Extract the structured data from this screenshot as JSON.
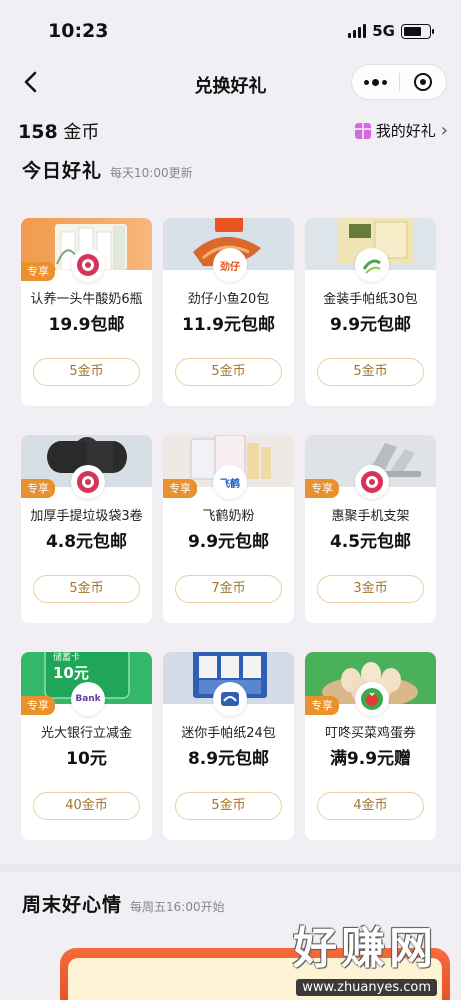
{
  "status_bar": {
    "time": "10:23",
    "network": "5G"
  },
  "nav": {
    "title": "兑换好礼"
  },
  "coins": {
    "amount": "158",
    "unit": "金币"
  },
  "my_gifts": {
    "label": "我的好礼",
    "arrow": "›"
  },
  "today": {
    "title": "今日好礼",
    "subtitle": "每天10:00更新"
  },
  "products": [
    {
      "name": "认养一头牛酸奶6瓶",
      "price": "19.9包邮",
      "cost": "5金币",
      "badge": "专享"
    },
    {
      "name": "劲仔小鱼20包",
      "price": "11.9元包邮",
      "cost": "5金币",
      "badge": ""
    },
    {
      "name": "金装手帕纸30包",
      "price": "9.9元包邮",
      "cost": "5金币",
      "badge": ""
    },
    {
      "name": "加厚手提垃圾袋3卷",
      "price": "4.8元包邮",
      "cost": "5金币",
      "badge": "专享"
    },
    {
      "name": "飞鹤奶粉",
      "price": "9.9元包邮",
      "cost": "7金币",
      "badge": "专享"
    },
    {
      "name": "惠聚手机支架",
      "price": "4.5元包邮",
      "cost": "3金币",
      "badge": "专享"
    },
    {
      "name": "光大银行立减金",
      "price": "10元",
      "cost": "40金币",
      "badge": "专享",
      "card_label": "储蓄卡",
      "card_value": "10元",
      "bank_mark": "Bank"
    },
    {
      "name": "迷你手帕纸24包",
      "price": "8.9元包邮",
      "cost": "5金币",
      "badge": ""
    },
    {
      "name": "叮咚买菜鸡蛋券",
      "price": "满9.9元赠",
      "cost": "4金币",
      "badge": "专享"
    }
  ],
  "brand_marks": {
    "jinzai": "劲仔",
    "feihe": "飞鹤"
  },
  "weekend": {
    "title": "周末好心情",
    "subtitle": "每周五16:00开始"
  },
  "watermark": {
    "text": "好赚网",
    "url": "www.zhuanyes.com"
  },
  "colors": {
    "badge": "#e8912e",
    "button_text": "#a57331",
    "button_border": "#e9cfa5",
    "page_bg": "#f1eef4"
  }
}
